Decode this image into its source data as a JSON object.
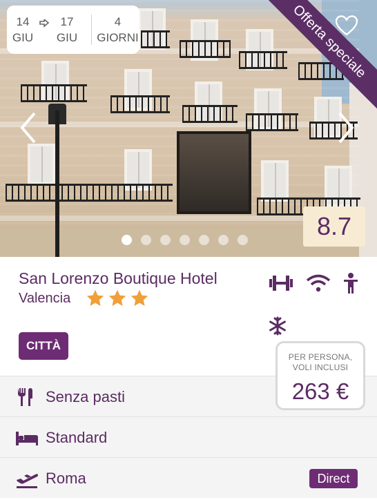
{
  "dates": {
    "checkin_day": "14",
    "checkin_month": "GIU",
    "checkout_day": "17",
    "checkout_month": "GIU",
    "days_count": "4",
    "days_label": "GIORNI"
  },
  "ribbon": "Offerta speciale",
  "score": "8.7",
  "gallery": {
    "total_images": 7,
    "active_index": 0
  },
  "hotel": {
    "name": "San Lorenzo Boutique Hotel",
    "city": "Valencia",
    "stars": 3,
    "tag": "CITTÀ"
  },
  "amenities": [
    "gym-icon",
    "wifi-icon",
    "kids-icon",
    "air-conditioning-icon"
  ],
  "price": {
    "caption_line1": "PER PERSONA,",
    "caption_line2": "VOLI INCLUSI",
    "value": "263 €"
  },
  "details": {
    "board": "Senza pasti",
    "room": "Standard",
    "departure": "Roma",
    "flight_badge": "Direct"
  },
  "colors": {
    "brand": "#5b2b63",
    "tag": "#6e2c75",
    "score_bg": "#f7ecd3",
    "star": "#f0a03a"
  }
}
